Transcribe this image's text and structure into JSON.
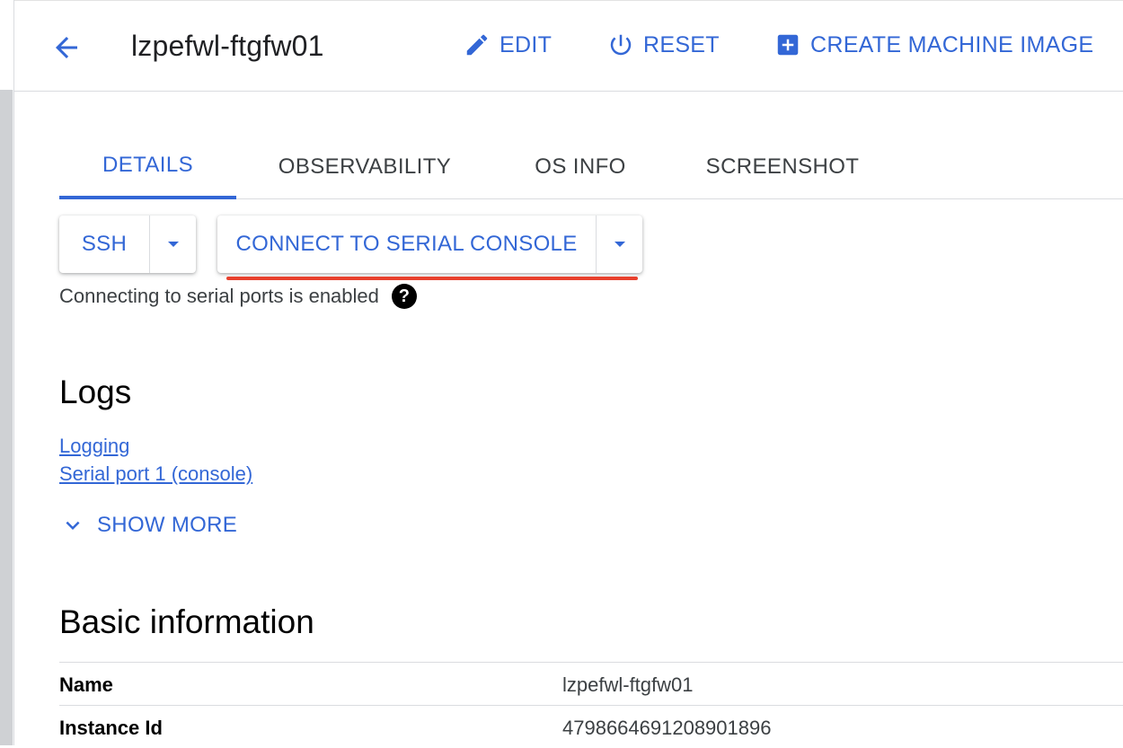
{
  "header": {
    "title": "lzpefwl-ftgfw01",
    "actions": {
      "edit": "EDIT",
      "reset": "RESET",
      "create_machine_image": "CREATE MACHINE IMAGE"
    },
    "accent_color": "#3367d6"
  },
  "tabs": [
    {
      "label": "DETAILS",
      "active": true
    },
    {
      "label": "OBSERVABILITY",
      "active": false
    },
    {
      "label": "OS INFO",
      "active": false
    },
    {
      "label": "SCREENSHOT",
      "active": false
    }
  ],
  "connect": {
    "ssh_label": "SSH",
    "serial_label": "CONNECT TO SERIAL CONSOLE",
    "serial_status": "Connecting to serial ports is enabled",
    "highlight_color": "#e8412e"
  },
  "logs": {
    "title": "Logs",
    "links": [
      "Logging",
      "Serial port 1 (console)"
    ],
    "show_more": "SHOW MORE"
  },
  "basic_info": {
    "title": "Basic information",
    "rows": [
      {
        "key": "Name",
        "value": "lzpefwl-ftgfw01"
      },
      {
        "key": "Instance Id",
        "value": "4798664691208901896"
      }
    ]
  },
  "icons": {
    "back": "arrow-back-icon",
    "edit": "pencil-icon",
    "reset": "power-icon",
    "create": "add-box-icon",
    "dropdown": "caret-down-icon",
    "help": "help-icon",
    "expand": "chevron-down-icon"
  }
}
